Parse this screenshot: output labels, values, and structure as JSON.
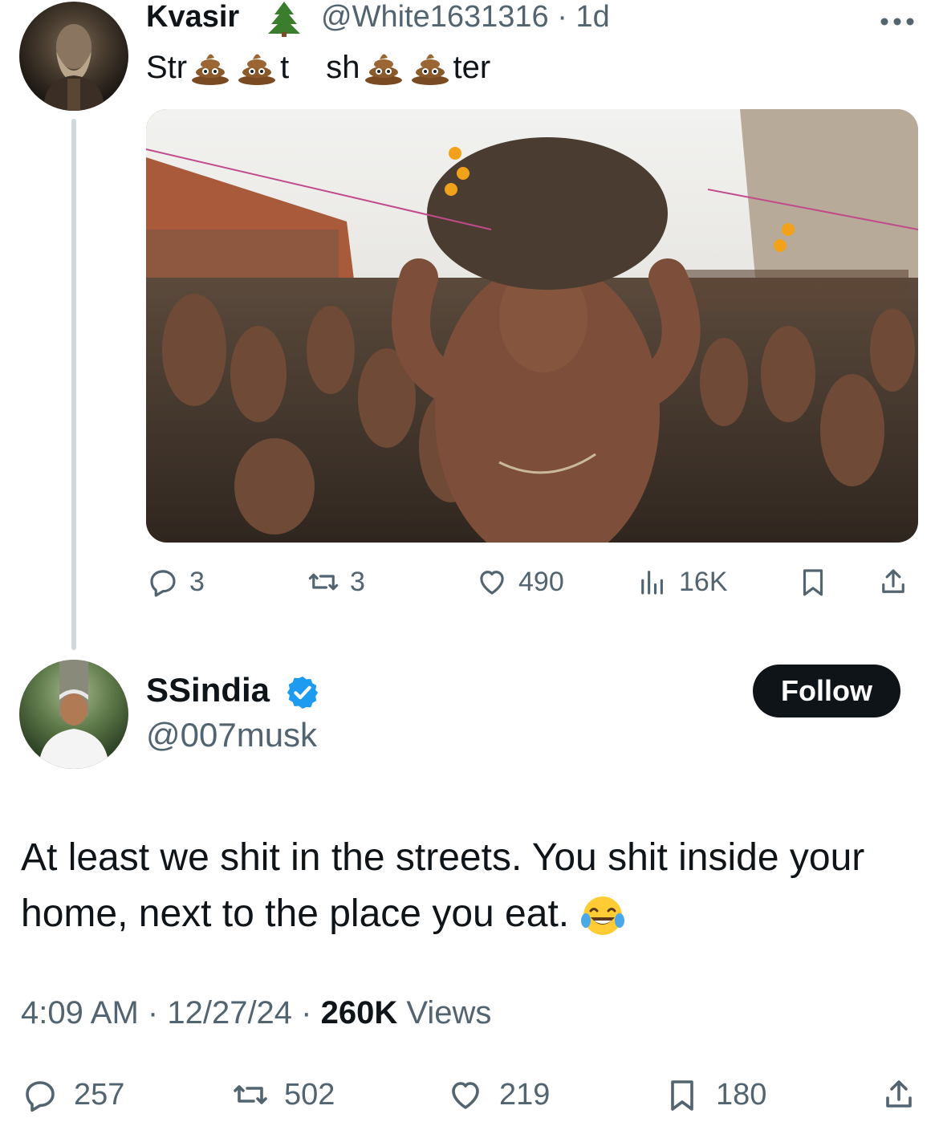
{
  "parent_tweet": {
    "display_name": "Kvasir",
    "name_emoji": "tree-emoji",
    "handle": "@White1631316",
    "separator": "·",
    "time_ago": "1d",
    "text_parts": [
      "Str",
      "t",
      "sh",
      "ter"
    ],
    "text_emoji": "pile-of-poo-emoji",
    "media_alt": "photo",
    "actions": {
      "replies": "3",
      "reposts": "3",
      "likes": "490",
      "views": "16K"
    }
  },
  "reply_tweet": {
    "display_name": "SSindia",
    "handle": "@007musk",
    "follow_label": "Follow",
    "text": "At least we shit in the streets. You shit inside your home, next to the place you eat.",
    "text_emoji": "laughing-tears-emoji",
    "time": "4:09 AM",
    "date": "12/27/24",
    "views_count": "260K",
    "views_label": "Views",
    "actions": {
      "replies": "257",
      "reposts": "502",
      "likes": "219",
      "bookmarks": "180"
    }
  },
  "colors": {
    "text_primary": "#0f1419",
    "text_secondary": "#536471",
    "thread_line": "#cfd9de",
    "verified_blue": "#1d9bf0",
    "follow_bg": "#0f1419"
  }
}
